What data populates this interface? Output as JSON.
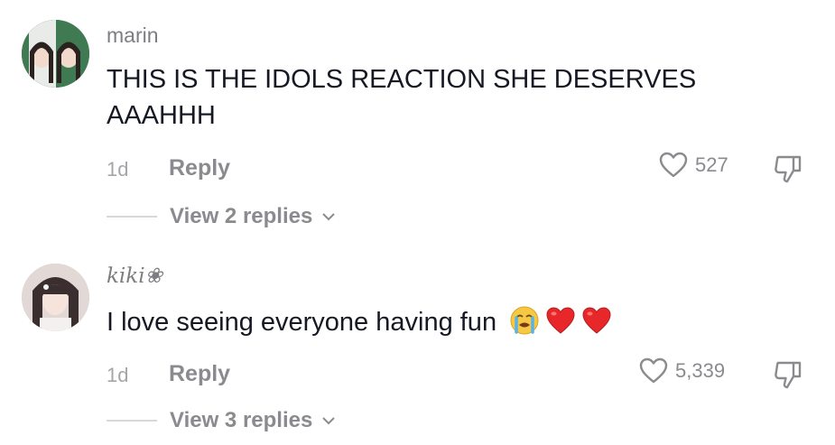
{
  "comments": [
    {
      "username": "marin",
      "text": "THIS IS THE IDOLS REACTION SHE DESERVES AAAHHH",
      "time": "1d",
      "reply_label": "Reply",
      "likes": "527",
      "view_replies": "View 2 replies"
    },
    {
      "username": "kiki❀",
      "text": "I love seeing everyone having fun",
      "time": "1d",
      "reply_label": "Reply",
      "likes": "5,339",
      "view_replies": "View 3 replies",
      "emojis": [
        "crying-face",
        "red-heart",
        "red-heart"
      ]
    }
  ],
  "colors": {
    "text_primary": "#161823",
    "text_secondary": "#8a8a8f",
    "heart_emoji": "#e8272b"
  }
}
